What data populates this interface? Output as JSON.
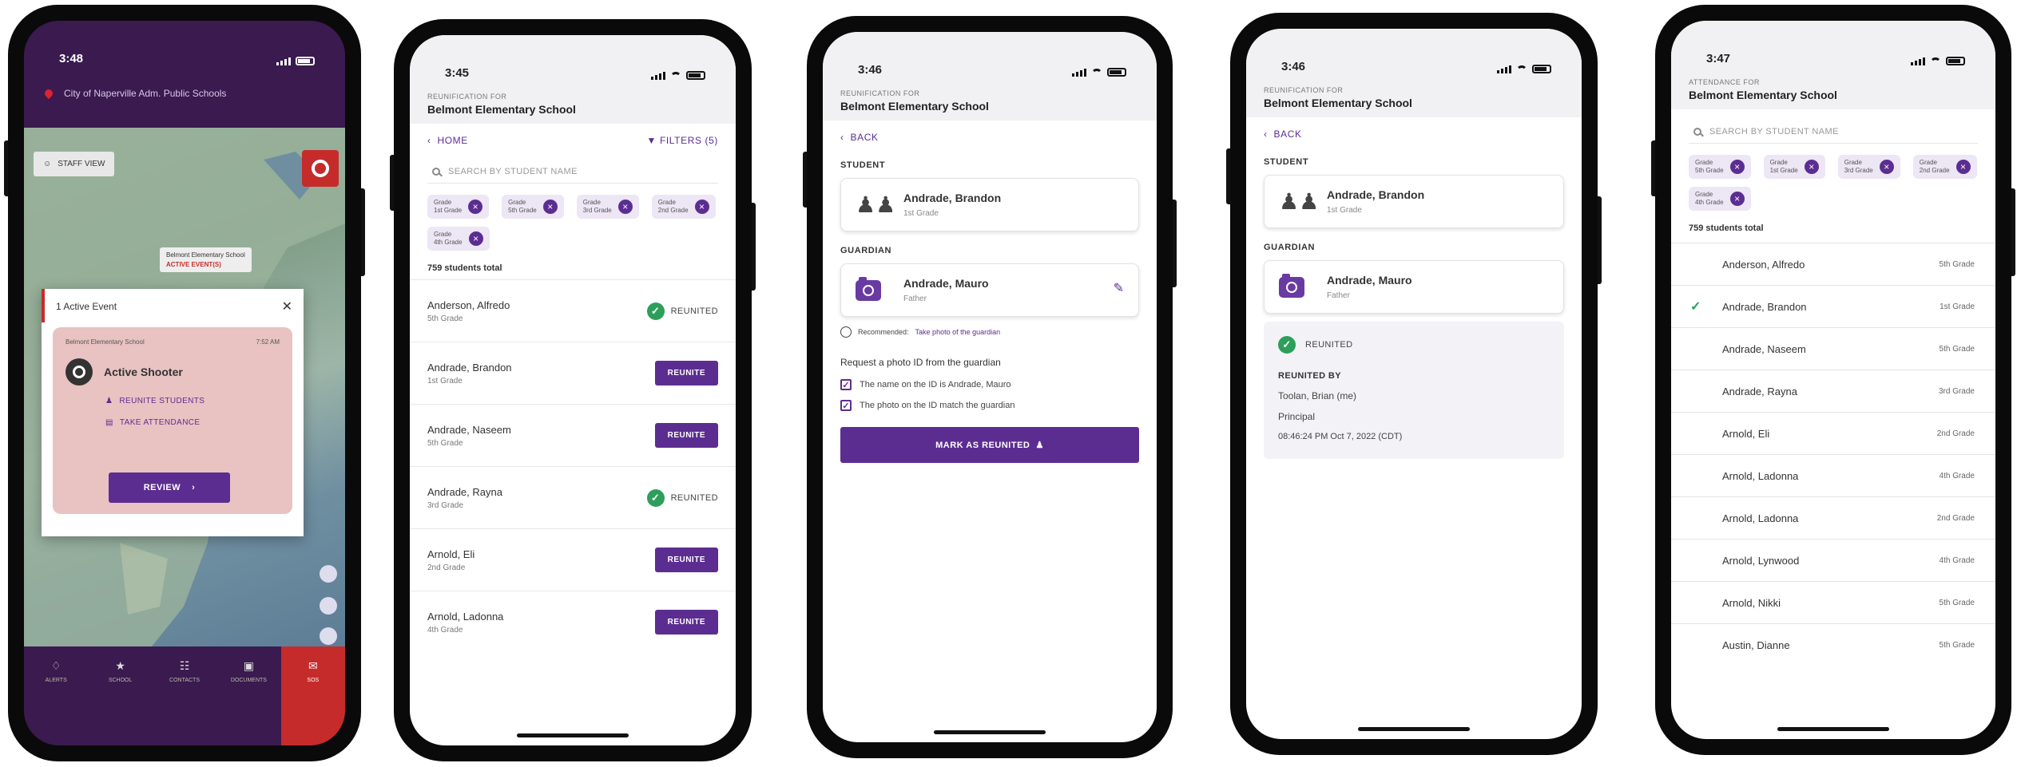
{
  "colors": {
    "brand_purple": "#5c2d91",
    "success_green": "#2e9e5b",
    "alert_red": "#c62b2b",
    "map_header": "#3a1a4f"
  },
  "phone1": {
    "time": "3:48",
    "district": "City of Naperville Adm. Public Schools",
    "staff_button": "STAFF VIEW",
    "map_label": "Belmont Elementary School",
    "map_sublabel": "ACTIVE EVENT(S)",
    "modal": {
      "title": "1 Active Event",
      "school": "Belmont Elementary School",
      "time": "7:52 AM",
      "event": "Active Shooter",
      "reunite": "REUNITE STUDENTS",
      "attendance": "TAKE ATTENDANCE",
      "review": "REVIEW"
    },
    "tabs": [
      {
        "label": "ALERTS",
        "icon": "bell-icon"
      },
      {
        "label": "SCHOOL",
        "icon": "school-icon"
      },
      {
        "label": "CONTACTS",
        "icon": "contacts-icon"
      },
      {
        "label": "DOCUMENTS",
        "icon": "folder-icon"
      },
      {
        "label": "SOS",
        "icon": "chat-icon"
      }
    ]
  },
  "phone2": {
    "time": "3:45",
    "header_sub": "REUNIFICATION FOR",
    "header_title": "Belmont Elementary School",
    "home": "HOME",
    "filters": "FILTERS (5)",
    "search_placeholder": "SEARCH BY STUDENT NAME",
    "chips": [
      {
        "line1": "Grade",
        "line2": "1st Grade"
      },
      {
        "line1": "Grade",
        "line2": "5th Grade"
      },
      {
        "line1": "Grade",
        "line2": "3rd Grade"
      },
      {
        "line1": "Grade",
        "line2": "2nd Grade"
      },
      {
        "line1": "Grade",
        "line2": "4th Grade"
      }
    ],
    "count": "759 students total",
    "reunite_label": "REUNITE",
    "reunited_label": "REUNITED",
    "students": [
      {
        "name": "Anderson, Alfredo",
        "grade": "5th Grade",
        "status": "reunited"
      },
      {
        "name": "Andrade, Brandon",
        "grade": "1st Grade",
        "status": "reunite"
      },
      {
        "name": "Andrade, Naseem",
        "grade": "5th Grade",
        "status": "reunite"
      },
      {
        "name": "Andrade, Rayna",
        "grade": "3rd Grade",
        "status": "reunited"
      },
      {
        "name": "Arnold, Eli",
        "grade": "2nd Grade",
        "status": "reunite"
      },
      {
        "name": "Arnold, Ladonna",
        "grade": "4th Grade",
        "status": "reunite"
      }
    ]
  },
  "phone3": {
    "time": "3:46",
    "header_sub": "REUNIFICATION FOR",
    "header_title": "Belmont Elementary School",
    "back": "BACK",
    "student_label": "STUDENT",
    "student_name": "Andrade, Brandon",
    "student_grade": "1st Grade",
    "guardian_label": "GUARDIAN",
    "guardian_name": "Andrade, Mauro",
    "guardian_rel": "Father",
    "recommended": "Recommended:",
    "take_photo": "Take photo of the guardian",
    "request": "Request a photo ID from the guardian",
    "check1": "The name on the ID is Andrade, Mauro",
    "check2": "The photo on the ID match the guardian",
    "mark_button": "MARK AS REUNITED"
  },
  "phone4": {
    "time": "3:46",
    "header_sub": "REUNIFICATION FOR",
    "header_title": "Belmont Elementary School",
    "back": "BACK",
    "student_label": "STUDENT",
    "student_name": "Andrade, Brandon",
    "student_grade": "1st Grade",
    "guardian_label": "GUARDIAN",
    "guardian_name": "Andrade, Mauro",
    "guardian_rel": "Father",
    "status": "REUNITED",
    "by_label": "REUNITED BY",
    "by_name": "Toolan, Brian (me)",
    "by_role": "Principal",
    "by_time": "08:46:24 PM Oct 7, 2022 (CDT)"
  },
  "phone5": {
    "time": "3:47",
    "header_sub": "ATTENDANCE FOR",
    "header_title": "Belmont Elementary School",
    "search_placeholder": "SEARCH BY STUDENT NAME",
    "chips": [
      {
        "line1": "Grade",
        "line2": "5th Grade"
      },
      {
        "line1": "Grade",
        "line2": "1st Grade"
      },
      {
        "line1": "Grade",
        "line2": "3rd Grade"
      },
      {
        "line1": "Grade",
        "line2": "2nd Grade"
      },
      {
        "line1": "Grade",
        "line2": "4th Grade"
      }
    ],
    "count": "759 students total",
    "students": [
      {
        "name": "Anderson, Alfredo",
        "grade": "5th Grade",
        "checked": false
      },
      {
        "name": "Andrade, Brandon",
        "grade": "1st Grade",
        "checked": true
      },
      {
        "name": "Andrade, Naseem",
        "grade": "5th Grade",
        "checked": false
      },
      {
        "name": "Andrade, Rayna",
        "grade": "3rd Grade",
        "checked": false
      },
      {
        "name": "Arnold, Eli",
        "grade": "2nd Grade",
        "checked": false
      },
      {
        "name": "Arnold, Ladonna",
        "grade": "4th Grade",
        "checked": false
      },
      {
        "name": "Arnold, Ladonna",
        "grade": "2nd Grade",
        "checked": false
      },
      {
        "name": "Arnold, Lynwood",
        "grade": "4th Grade",
        "checked": false
      },
      {
        "name": "Arnold, Nikki",
        "grade": "5th Grade",
        "checked": false
      },
      {
        "name": "Austin, Dianne",
        "grade": "5th Grade",
        "checked": false
      }
    ]
  }
}
